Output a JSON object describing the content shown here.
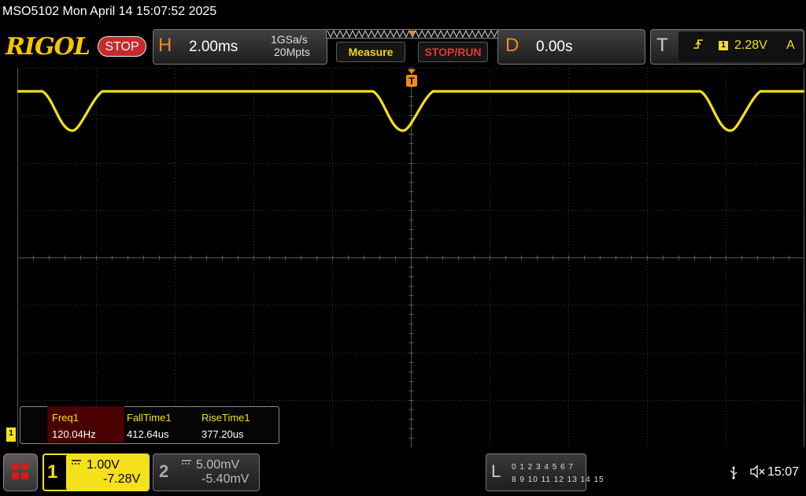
{
  "window": {
    "title": "MSO5102  Mon April 14 15:07:52 2025"
  },
  "toolbar": {
    "logo": "RIGOL",
    "status": "STOP",
    "horizontal": {
      "letter": "H",
      "scale": "2.00ms",
      "sample_rate": "1GSa/s",
      "memory_depth": "20Mpts"
    },
    "measure_label": "Measure",
    "stop_run_label": "STOP/RUN",
    "delay": {
      "letter": "D",
      "value": "0.00s"
    },
    "trigger": {
      "letter": "T",
      "edge_icon": "rising-edge-icon",
      "source": "1",
      "level": "2.28V",
      "mode": "A"
    }
  },
  "screen": {
    "trigger_marker": "T",
    "ch1_marker": "1",
    "trace_color": "#f4e01b",
    "grid_color": "#3a3a3a"
  },
  "measurements": [
    {
      "label": "Freq1",
      "value": "120.04Hz"
    },
    {
      "label": "FallTime1",
      "value": "412.64us"
    },
    {
      "label": "RiseTime1",
      "value": "377.20us"
    }
  ],
  "bottom": {
    "menu_icon": "grid-menu-icon",
    "ch1": {
      "number": "1",
      "coupling_icon": "dc-coupling-icon",
      "scale": "1.00V",
      "offset": "-7.28V"
    },
    "ch2": {
      "number": "2",
      "coupling_icon": "dc-coupling-icon",
      "scale": "5.00mV",
      "offset": "-5.40mV"
    },
    "logic": {
      "letter": "L",
      "row1": "0 1 2 3  4 5 6 7",
      "row2": "8 9 10 11 12 13 14 15"
    },
    "usb_icon": "usb-icon",
    "mute_icon": "speaker-mute-icon",
    "time": "15:07"
  }
}
